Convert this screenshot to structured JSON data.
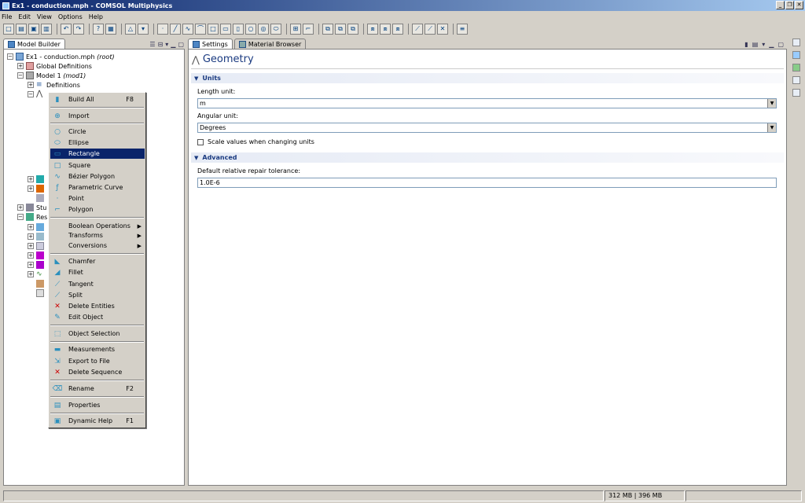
{
  "window": {
    "title": "Ex1 - conduction.mph - COMSOL Multiphysics"
  },
  "menubar": [
    "File",
    "Edit",
    "View",
    "Options",
    "Help"
  ],
  "left_panel": {
    "tab": "Model Builder",
    "tree": [
      {
        "label": "Ex1 - conduction.mph",
        "suffix": "(root)"
      },
      {
        "label": "Global Definitions"
      },
      {
        "label": "Model 1",
        "suffix": "(mod1)"
      },
      {
        "label": "Definitions"
      },
      {
        "label": "Stu"
      },
      {
        "label": "Res"
      }
    ]
  },
  "context_menu": {
    "items": [
      {
        "label": "Build All",
        "shortcut": "F8",
        "icon": "build-icon"
      },
      {
        "label": "Import",
        "icon": "import-icon"
      },
      {
        "label": "Circle",
        "icon": "circle-icon"
      },
      {
        "label": "Ellipse",
        "icon": "ellipse-icon"
      },
      {
        "label": "Rectangle",
        "icon": "rectangle-icon",
        "selected": true
      },
      {
        "label": "Square",
        "icon": "square-icon"
      },
      {
        "label": "Bézier Polygon",
        "icon": "bezier-icon"
      },
      {
        "label": "Parametric Curve",
        "icon": "parametric-curve-icon"
      },
      {
        "label": "Point",
        "icon": "point-icon"
      },
      {
        "label": "Polygon",
        "icon": "polygon-icon"
      },
      {
        "label": "Boolean Operations",
        "submenu": true
      },
      {
        "label": "Transforms",
        "submenu": true
      },
      {
        "label": "Conversions",
        "submenu": true
      },
      {
        "label": "Chamfer",
        "icon": "chamfer-icon"
      },
      {
        "label": "Fillet",
        "icon": "fillet-icon"
      },
      {
        "label": "Tangent",
        "icon": "tangent-icon"
      },
      {
        "label": "Split",
        "icon": "split-icon"
      },
      {
        "label": "Delete Entities",
        "icon": "delete-entities-icon"
      },
      {
        "label": "Edit Object",
        "icon": "edit-object-icon"
      },
      {
        "label": "Object Selection",
        "icon": "object-selection-icon"
      },
      {
        "label": "Measurements",
        "icon": "measurements-icon"
      },
      {
        "label": "Export to File",
        "icon": "export-icon"
      },
      {
        "label": "Delete Sequence",
        "icon": "delete-sequence-icon"
      },
      {
        "label": "Rename",
        "shortcut": "F2",
        "icon": "rename-icon"
      },
      {
        "label": "Properties",
        "icon": "properties-icon"
      },
      {
        "label": "Dynamic Help",
        "shortcut": "F1",
        "icon": "help-icon"
      }
    ]
  },
  "settings": {
    "tabs": [
      "Settings",
      "Material Browser"
    ],
    "title": "Geometry",
    "units": {
      "header": "Units",
      "length_label": "Length unit:",
      "length_value": "m",
      "angular_label": "Angular unit:",
      "angular_value": "Degrees",
      "scale_label": "Scale values when changing units"
    },
    "advanced": {
      "header": "Advanced",
      "tolerance_label": "Default relative repair tolerance:",
      "tolerance_value": "1.0E-6"
    }
  },
  "status": {
    "memory": "312 MB | 396 MB"
  }
}
